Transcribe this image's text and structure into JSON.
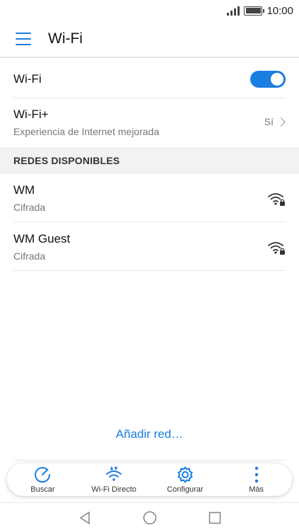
{
  "status_bar": {
    "time": "10:00"
  },
  "app_bar": {
    "title": "Wi-Fi"
  },
  "wifi": {
    "label": "Wi-Fi",
    "enabled": true
  },
  "wifi_plus": {
    "title": "Wi-Fi+",
    "subtitle": "Experiencia de Internet mejorada",
    "value": "Sí"
  },
  "available_networks": {
    "header": "REDES DISPONIBLES",
    "items": [
      {
        "name": "WM",
        "security": "Cifrada"
      },
      {
        "name": "WM Guest",
        "security": "Cifrada"
      }
    ]
  },
  "add_network": {
    "label": "Añadir red…"
  },
  "bottom_actions": [
    {
      "label": "Buscar",
      "icon": "search-icon"
    },
    {
      "label": "Wi-Fi Directo",
      "icon": "wifi-direct-icon"
    },
    {
      "label": "Configurar",
      "icon": "gear-icon"
    },
    {
      "label": "Más",
      "icon": "more-vertical-icon"
    }
  ],
  "colors": {
    "accent": "#1a7de0"
  }
}
